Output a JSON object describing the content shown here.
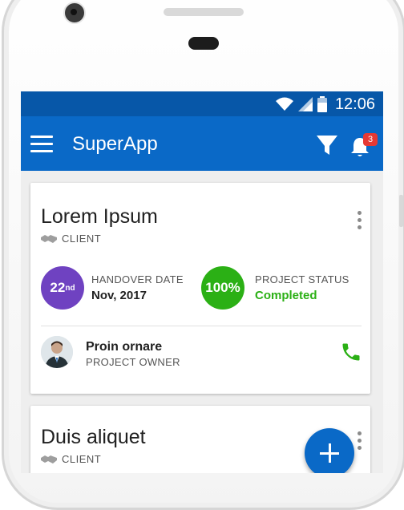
{
  "status_bar": {
    "time": "12:06"
  },
  "app_bar": {
    "title": "SuperApp",
    "notification_count": "3"
  },
  "colors": {
    "primary": "#0a69c7",
    "status_bar": "#0757a8",
    "date_circle": "#6f42c1",
    "status_circle": "#2bb015",
    "completed_text": "#2bb015",
    "badge": "#e53935"
  },
  "cards": [
    {
      "title": "Lorem Ipsum",
      "client_label": "CLIENT",
      "handover": {
        "day": "22",
        "suffix": "nd",
        "label": "HANDOVER DATE",
        "value": "Nov, 2017"
      },
      "status": {
        "percent": "100%",
        "label": "PROJECT STATUS",
        "value": "Completed"
      },
      "owner": {
        "name": "Proin ornare",
        "role": "PROJECT OWNER"
      }
    },
    {
      "title": "Duis aliquet",
      "client_label": "CLIENT"
    }
  ],
  "icons": [
    "menu-icon",
    "filter-icon",
    "bell-icon",
    "handshake-icon",
    "more-vert-icon",
    "phone-icon",
    "add-icon",
    "wifi-icon",
    "signal-icon",
    "battery-icon"
  ]
}
